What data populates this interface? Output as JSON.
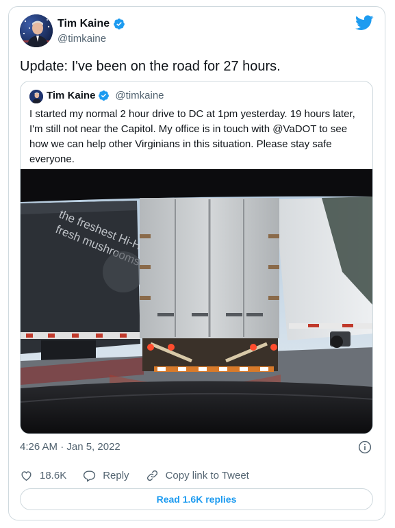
{
  "author": {
    "name": "Tim Kaine",
    "handle": "@timkaine"
  },
  "tweet": {
    "text": "Update: I've been on the road for 27 hours."
  },
  "quoted_tweet": {
    "name": "Tim Kaine",
    "handle": "@timkaine",
    "text": "I started my normal 2 hour drive to DC at 1pm yesterday. 19 hours later, I'm still not near the Capitol. My office is in touch with @VaDOT to see how we can help other Virginians in this situation. Please stay safe everyone.",
    "media_trailer_text": "the freshest Hi-Health fresh mushrooms"
  },
  "footer": {
    "timestamp": "4:26 AM · Jan 5, 2022",
    "likes": "18.6K",
    "reply_label": "Reply",
    "copy_label": "Copy link to Tweet",
    "read_replies": "Read 1.6K replies"
  },
  "colors": {
    "brand": "#1d9bf0",
    "text": "#0f1419",
    "muted": "#536471",
    "border": "#cfd9de"
  },
  "icons": [
    "twitter-bird-icon",
    "verified-badge-icon",
    "info-icon",
    "heart-icon",
    "reply-icon",
    "link-icon"
  ]
}
